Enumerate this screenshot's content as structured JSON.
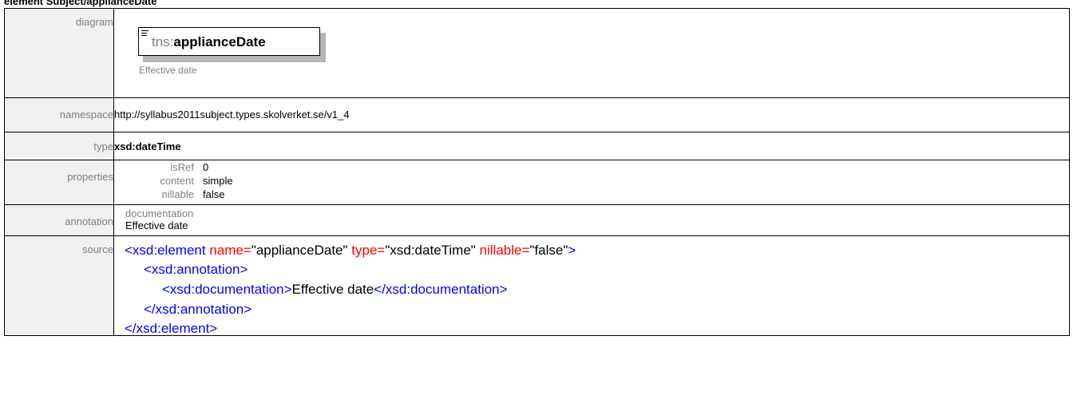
{
  "heading": "element Subject/applianceDate",
  "labels": {
    "diagram": "diagram",
    "namespace": "namespace",
    "type": "type",
    "properties": "properties",
    "annotation": "annotation",
    "source": "source"
  },
  "diagram": {
    "prefix": "tns:",
    "local_name": "applianceDate",
    "documentation": "Effective date"
  },
  "namespace": "http://syllabus2011subject.types.skolverket.se/v1_4",
  "type": "xsd:dateTime",
  "properties": [
    {
      "key": "isRef",
      "value": "0"
    },
    {
      "key": "content",
      "value": "simple"
    },
    {
      "key": "nillable",
      "value": "false"
    }
  ],
  "annotation": {
    "key": "documentation",
    "value": "Effective date"
  },
  "source": {
    "l1_open": "<xsd:element",
    "l1_attr1": " name=",
    "l1_val1": "\"applianceDate\"",
    "l1_attr2": " type=",
    "l1_val2": "\"xsd:dateTime\"",
    "l1_attr3": " nillable=",
    "l1_val3": "\"false\"",
    "l1_close": ">",
    "l2": "<xsd:annotation>",
    "l3_open": "<xsd:documentation>",
    "l3_text": "Effective date",
    "l3_close": "</xsd:documentation>",
    "l4": "</xsd:annotation>",
    "l5": "</xsd:element>"
  }
}
